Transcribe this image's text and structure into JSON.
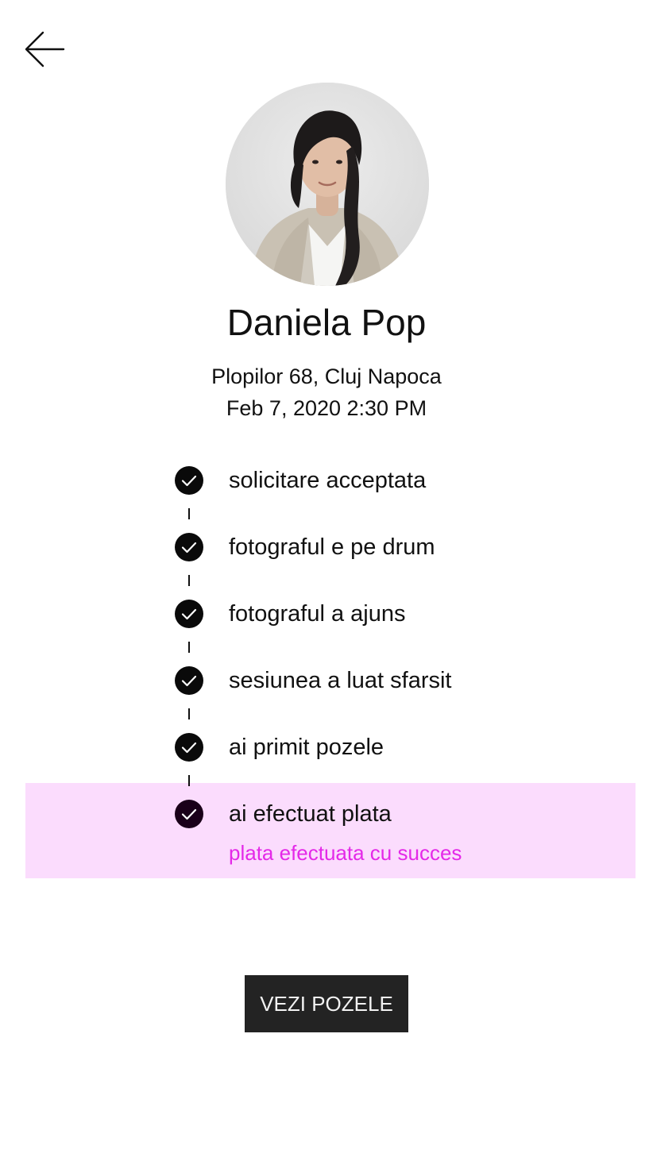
{
  "header": {
    "back_icon": "arrow-left-icon"
  },
  "profile": {
    "name": "Daniela Pop",
    "address": "Plopilor 68, Cluj Napoca",
    "datetime": "Feb 7, 2020 2:30 PM"
  },
  "timeline": {
    "steps": [
      {
        "label": "solicitare acceptata",
        "icon": "check-circle-icon",
        "completed": true
      },
      {
        "label": "fotograful e pe drum",
        "icon": "check-circle-icon",
        "completed": true
      },
      {
        "label": "fotograful a ajuns",
        "icon": "check-circle-icon",
        "completed": true
      },
      {
        "label": "sesiunea a luat sfarsit",
        "icon": "check-circle-icon",
        "completed": true
      },
      {
        "label": "ai primit pozele",
        "icon": "check-circle-icon",
        "completed": true
      },
      {
        "label": "ai efectuat plata",
        "icon": "check-circle-icon",
        "completed": true,
        "active": true,
        "status": "plata efectuata cu succes"
      }
    ]
  },
  "actions": {
    "view_photos_label": "VEZI POZELE"
  },
  "colors": {
    "highlight_background": "#fbdcfd",
    "status_text": "#e429e8",
    "button_background": "#232323",
    "check_fill": "#0a0a0a"
  }
}
